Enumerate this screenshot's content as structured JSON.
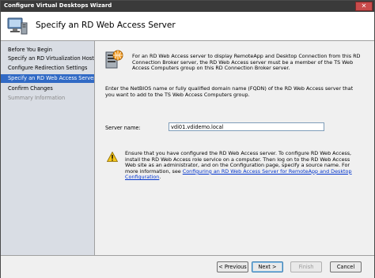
{
  "window": {
    "title": "Configure Virtual Desktops Wizard",
    "close_glyph": "✕"
  },
  "header": {
    "title": "Specify an RD Web Access Server",
    "icon": "wizard-computer-icon"
  },
  "sidebar": {
    "steps": [
      {
        "label": "Before You Begin",
        "state": "normal"
      },
      {
        "label": "Specify an RD Virtualization Host ...",
        "state": "normal"
      },
      {
        "label": "Configure Redirection Settings",
        "state": "normal"
      },
      {
        "label": "Specify an RD Web Access Server",
        "state": "active"
      },
      {
        "label": "Confirm Changes",
        "state": "normal"
      },
      {
        "label": "Summary Information",
        "state": "disabled"
      }
    ]
  },
  "main": {
    "description": "For an RD Web Access server to display RemoteApp and Desktop Connection from this RD Connection Broker server, the RD Web Access server must be a member of the TS Web Access Computers group on this RD Connection Broker server.",
    "netbios_prompt": "Enter the NetBIOS name or fully qualified domain name (FQDN) of the RD Web Access server that you want to add to the TS Web Access Computers group.",
    "server_name_label": "Server name:",
    "server_name_value": "vdi01.vdidemo.local",
    "warning_text": "Ensure that you have configured the RD Web Access server. To configure RD Web Access, install the RD Web Access role service on a computer. Then log on to the RD Web Access Web site as an administrator, and on the Configuration page, specify a source name. For more information, see ",
    "warning_link": "Configuring an RD Web Access Server for RemoteApp and Desktop Configuration",
    "warning_tail": "."
  },
  "footer": {
    "previous_label": "< Previous",
    "next_label": "Next >",
    "finish_label": "Finish",
    "cancel_label": "Cancel"
  },
  "colors": {
    "active_step": "#316ac5",
    "link": "#0033cc",
    "titlebar": "#3a3a3a"
  }
}
